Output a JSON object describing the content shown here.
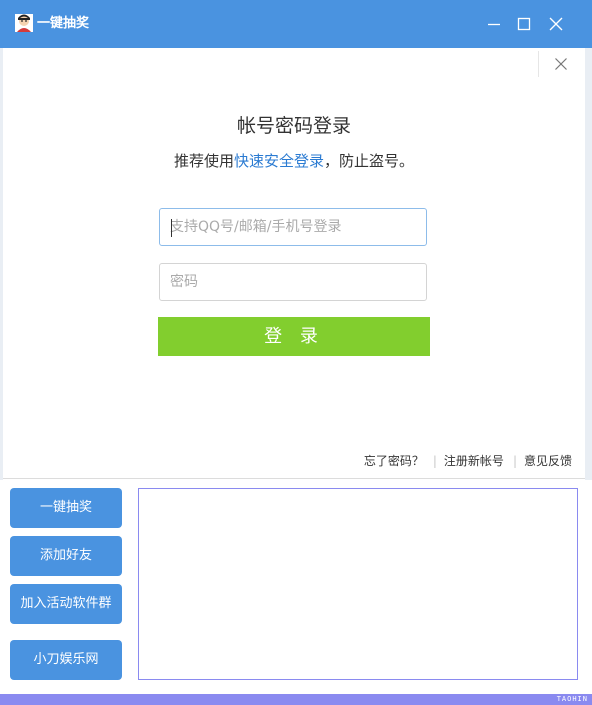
{
  "window": {
    "title": "一键抽奖",
    "icon": "avatar-icon",
    "accent_color": "#4a93e0"
  },
  "login": {
    "title": "帐号密码登录",
    "subtitle_prefix": "推荐使用",
    "subtitle_link": "快速安全登录",
    "subtitle_suffix": "，防止盗号。",
    "account_placeholder": "支持QQ号/邮箱/手机号登录",
    "account_value": "",
    "password_placeholder": "密码",
    "password_value": "",
    "login_button": "登 录",
    "login_button_color": "#82ce2e",
    "links": {
      "forgot": "忘了密码？",
      "register": "注册新帐号",
      "feedback": "意见反馈"
    }
  },
  "sidebar": {
    "buttons": [
      "一键抽奖",
      "添加好友",
      "加入活动软件群",
      "小刀娱乐网"
    ]
  },
  "output": {
    "value": ""
  },
  "status": {
    "text": "TAOHIN",
    "color": "#8a8af0"
  }
}
